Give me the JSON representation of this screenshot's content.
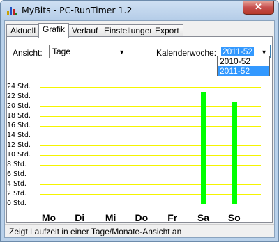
{
  "window": {
    "title": "MyBits - PC-RunTimer 1.2",
    "close_label": "✕"
  },
  "tabs": [
    {
      "label": "Aktuell",
      "active": false
    },
    {
      "label": "Grafik",
      "active": true
    },
    {
      "label": "Verlauf",
      "active": false
    },
    {
      "label": "Einstellungen",
      "active": false
    },
    {
      "label": "Export",
      "active": false
    }
  ],
  "controls": {
    "ansicht_label": "Ansicht:",
    "ansicht_value": "Tage",
    "kw_label": "Kalenderwoche:",
    "kw_value": "2011-52",
    "kw_options": [
      "2010-52",
      "2011-52"
    ],
    "kw_selected_option": "2011-52"
  },
  "chart_data": {
    "type": "bar",
    "categories": [
      "Mo",
      "Di",
      "Mi",
      "Do",
      "Fr",
      "Sa",
      "So"
    ],
    "values": [
      0,
      0,
      0,
      0,
      0,
      23,
      21
    ],
    "ylim": [
      0,
      24
    ],
    "yticks": [
      "0 Std.",
      "2 Std.",
      "4 Std.",
      "6 Std.",
      "8 Std.",
      "10 Std.",
      "12 Std.",
      "14 Std.",
      "16 Std.",
      "18 Std.",
      "20 Std.",
      "22 Std.",
      "24 Std."
    ],
    "bar_color": "#00ff00",
    "grid_color": "#f5f500",
    "grid": true
  },
  "status": {
    "text": "Zeigt Laufzeit in einer Tage/Monate-Ansicht an"
  }
}
